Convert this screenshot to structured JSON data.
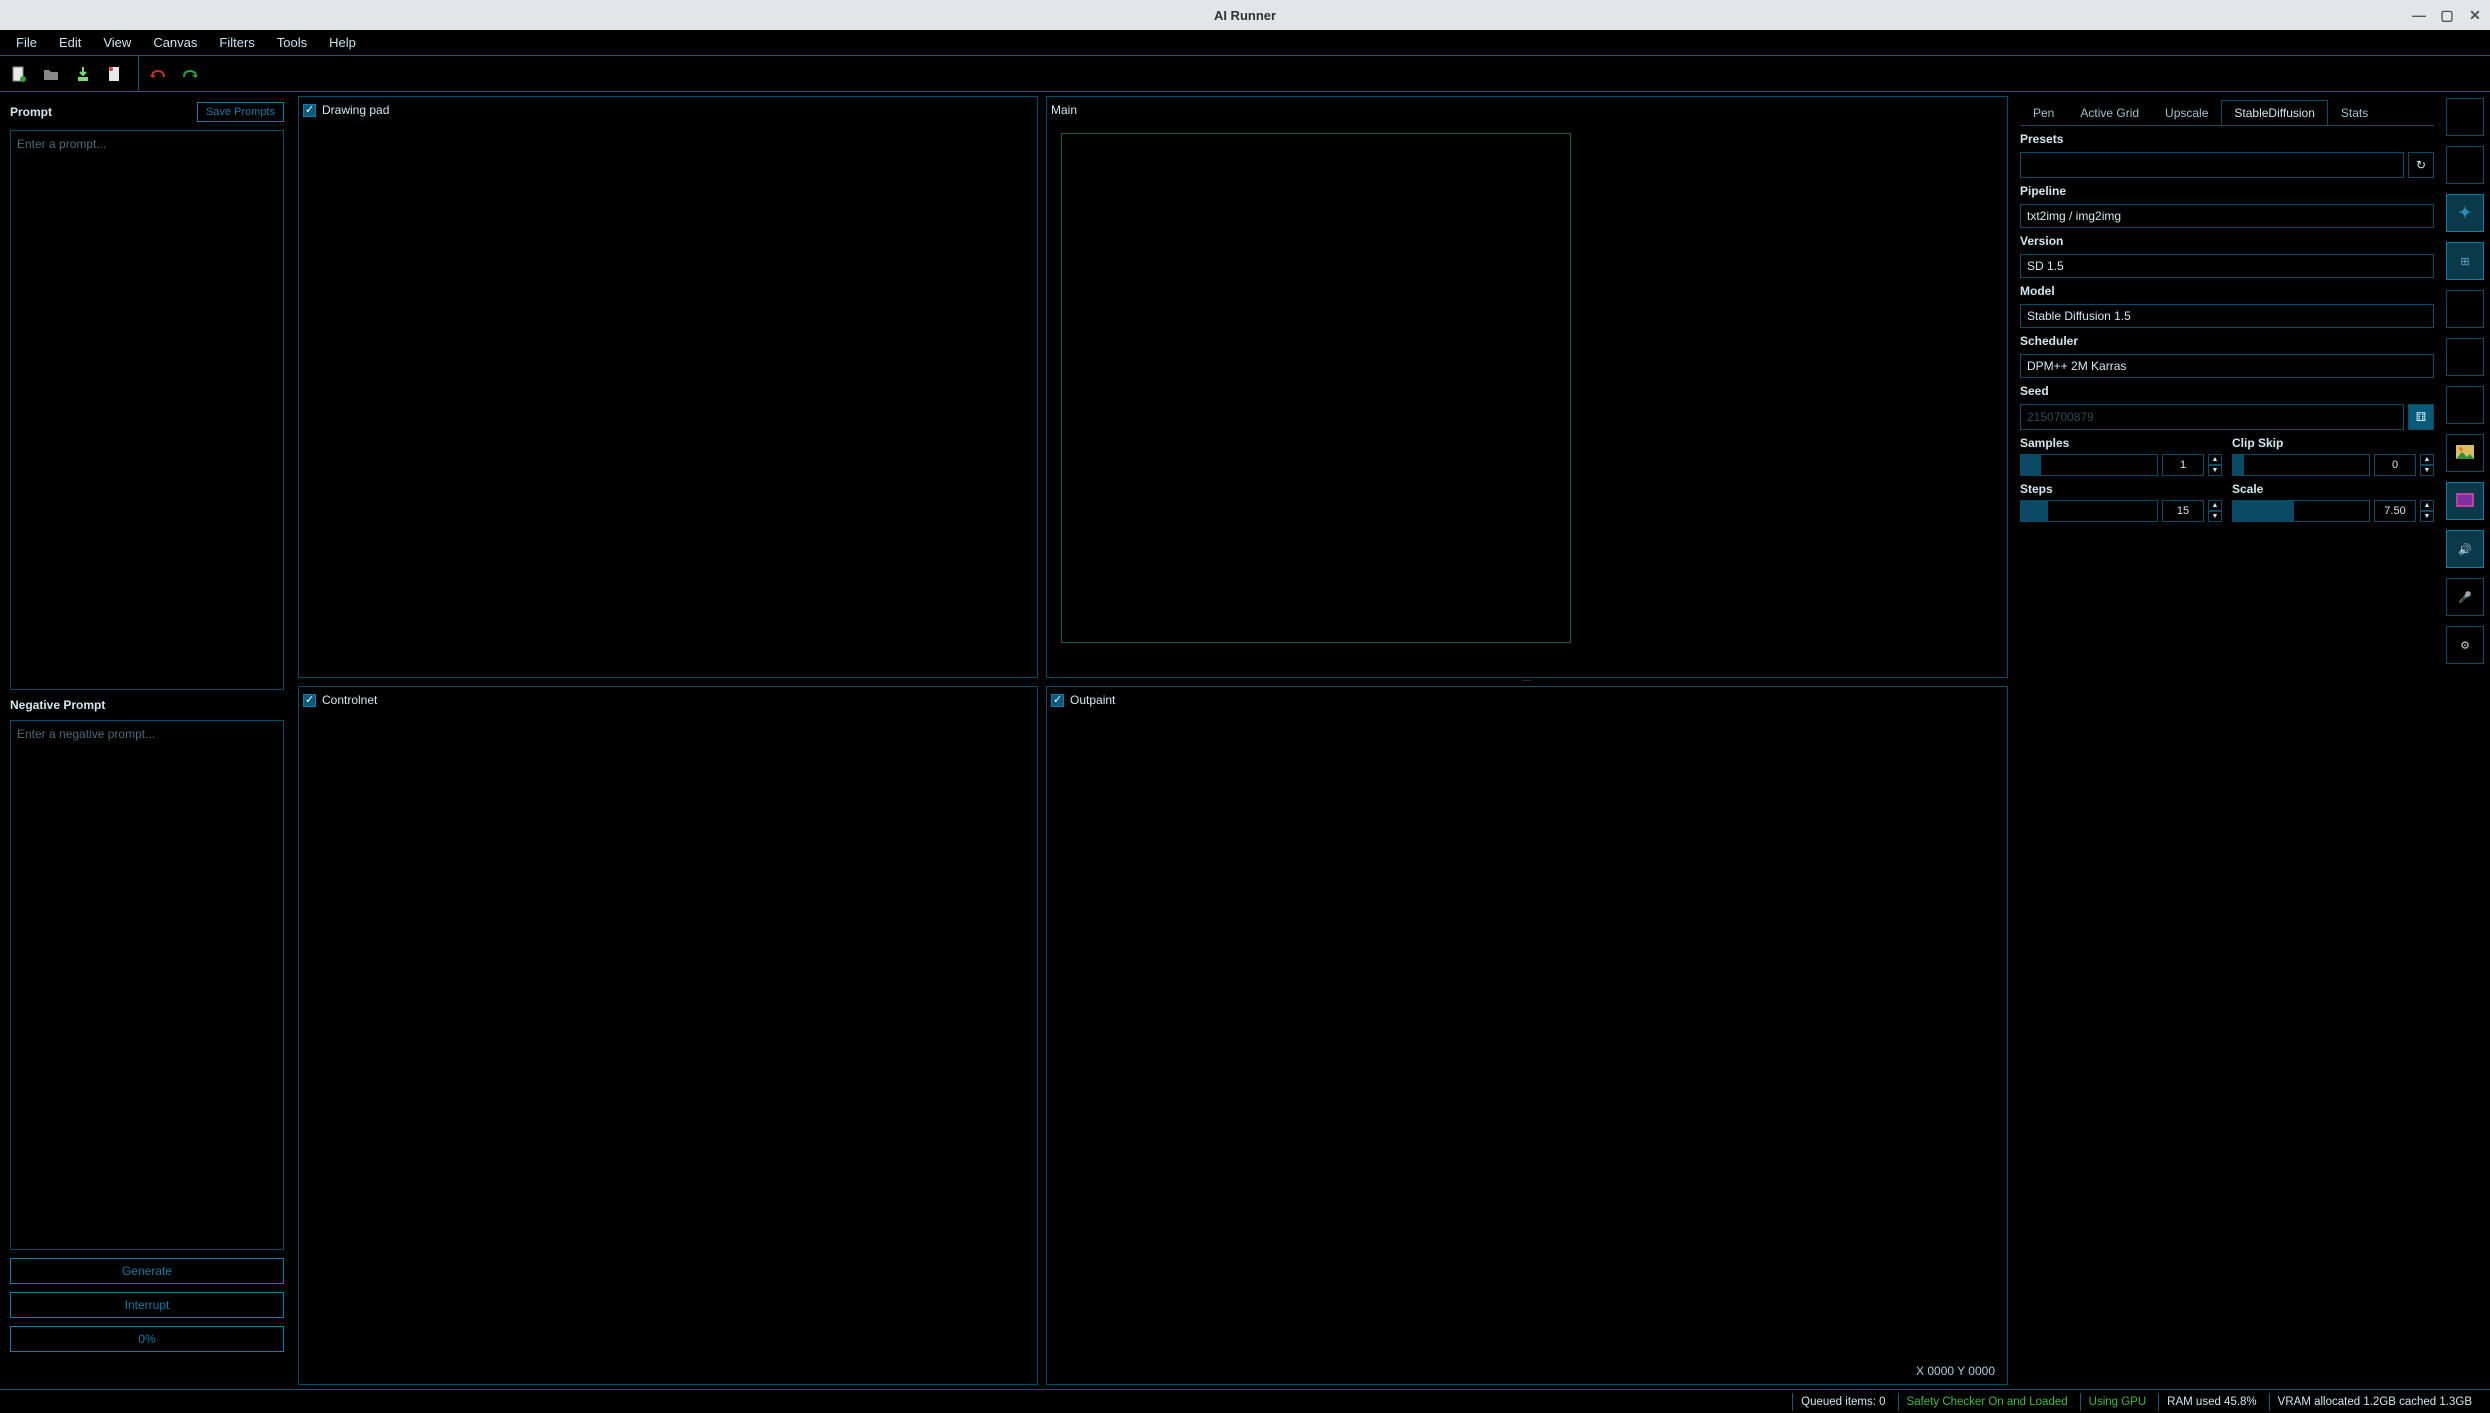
{
  "title": "AI Runner",
  "menubar": [
    "File",
    "Edit",
    "View",
    "Canvas",
    "Filters",
    "Tools",
    "Help"
  ],
  "left": {
    "prompt_label": "Prompt",
    "save_prompts": "Save Prompts",
    "prompt_placeholder": "Enter a prompt...",
    "neg_prompt_label": "Negative Prompt",
    "neg_prompt_placeholder": "Enter a negative prompt...",
    "generate": "Generate",
    "interrupt": "Interrupt",
    "progress": "0%"
  },
  "canvas": {
    "drawing_pad": "Drawing pad",
    "main": "Main",
    "controlnet": "Controlnet",
    "outpaint": "Outpaint",
    "coords": "X  0000 Y  0000"
  },
  "tabs": [
    "Pen",
    "Active Grid",
    "Upscale",
    "StableDiffusion",
    "Stats"
  ],
  "sd": {
    "presets_label": "Presets",
    "pipeline_label": "Pipeline",
    "pipeline_value": "txt2img / img2img",
    "version_label": "Version",
    "version_value": "SD 1.5",
    "model_label": "Model",
    "model_value": "Stable Diffusion 1.5",
    "scheduler_label": "Scheduler",
    "scheduler_value": "DPM++ 2M Karras",
    "seed_label": "Seed",
    "seed_placeholder": "2150700879",
    "samples_label": "Samples",
    "samples_value": "1",
    "clipskip_label": "Clip Skip",
    "clipskip_value": "0",
    "steps_label": "Steps",
    "steps_value": "15",
    "scale_label": "Scale",
    "scale_value": "7.50"
  },
  "status": {
    "queued": "Queued items: 0",
    "safety": "Safety Checker On and Loaded",
    "gpu": "Using GPU",
    "ram": "RAM used 45.8%",
    "vram": "VRAM allocated 1.2GB cached 1.3GB"
  }
}
